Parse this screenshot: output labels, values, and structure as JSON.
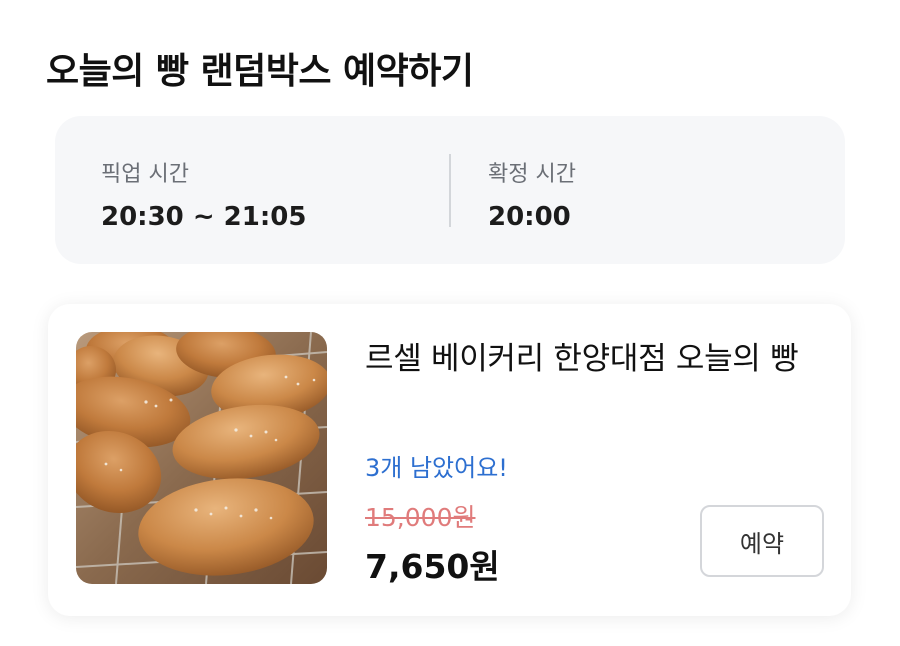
{
  "page": {
    "title": "오늘의 빵 랜덤박스 예약하기"
  },
  "times": {
    "pickup": {
      "label": "픽업 시간",
      "value": "20:30 ~ 21:05"
    },
    "confirm": {
      "label": "확정 시간",
      "value": "20:00"
    }
  },
  "product": {
    "image_icon": "bread-photo",
    "name": "르셀 베이커리 한양대점 오늘의 빵",
    "remaining": "3개 남았어요!",
    "original_price": "15,000원",
    "sale_price": "7,650원",
    "reserve_label": "예약"
  },
  "colors": {
    "remaining": "#2d6fd0",
    "original_price": "#e07b7b",
    "card_bg": "#f6f7f9"
  }
}
